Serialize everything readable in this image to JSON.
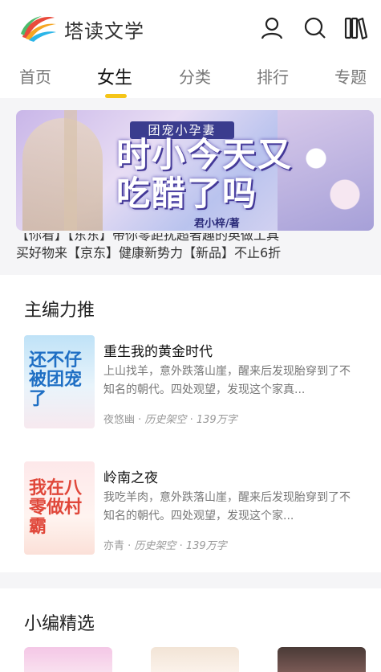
{
  "header": {
    "brand": "塔读文学",
    "logo_icon": "tadu-logo-icon",
    "icons": [
      "user-icon",
      "search-icon",
      "bookshelf-icon"
    ]
  },
  "tabs": [
    {
      "label": "首页",
      "active": false
    },
    {
      "label": "女生",
      "active": true
    },
    {
      "label": "分类",
      "active": false
    },
    {
      "label": "排行",
      "active": false
    },
    {
      "label": "专题",
      "active": false
    }
  ],
  "banner": {
    "subtitle": "团宠小孕妻",
    "title": "时小今天又吃醋了吗",
    "author": "君小梓/著",
    "ticker": [
      "【你看】【东东】带你零距扰超者趣的英做工具",
      "买好物来【京东】健康新势力【新品】不止6折"
    ]
  },
  "sections": {
    "featured": {
      "title": "主编力推",
      "books": [
        {
          "title": "重生我的黄金时代",
          "desc": "上山找羊，意外跌落山崖，醒来后发现胎穿到了不知名的朝代。四处观望，发现这个家真...",
          "author": "夜悠幽",
          "category": "历史架空",
          "words": "139万字",
          "cover_text": "还不仔被团宠了"
        },
        {
          "title": "岭南之夜",
          "desc": "我吃羊肉，意外跌落山崖，醒来后发现胎穿到了不知名的朝代。四处观望，发现这个家...",
          "author": "亦青",
          "category": "历史架空",
          "words": "139万字",
          "cover_text": "我在八零做村霸"
        }
      ]
    },
    "picks": {
      "title": "小编精选"
    }
  },
  "colors": {
    "accent": "#f5c518",
    "tab_active": "#111111",
    "tab_inactive": "#777777"
  }
}
